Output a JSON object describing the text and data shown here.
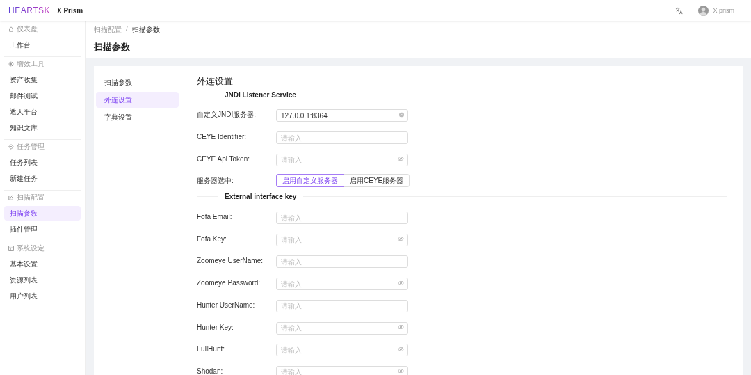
{
  "header": {
    "logo": "HEARTSK",
    "app_name": "X Prism",
    "user": "X prism"
  },
  "sidebar": {
    "groups": [
      {
        "title": "仪表盘",
        "items": [
          {
            "label": "工作台",
            "selected": false
          }
        ]
      },
      {
        "title": "增效工具",
        "items": [
          {
            "label": "资产收集",
            "selected": false
          },
          {
            "label": "邮件测试",
            "selected": false
          },
          {
            "label": "遮天平台",
            "selected": false
          },
          {
            "label": "知识文库",
            "selected": false
          }
        ]
      },
      {
        "title": "任务管理",
        "items": [
          {
            "label": "任务列表",
            "selected": false
          },
          {
            "label": "新建任务",
            "selected": false
          }
        ]
      },
      {
        "title": "扫描配置",
        "items": [
          {
            "label": "扫描参数",
            "selected": true
          },
          {
            "label": "插件管理",
            "selected": false
          }
        ]
      },
      {
        "title": "系统设定",
        "items": [
          {
            "label": "基本设置",
            "selected": false
          },
          {
            "label": "资源列表",
            "selected": false
          },
          {
            "label": "用户列表",
            "selected": false
          }
        ]
      }
    ]
  },
  "breadcrumb": {
    "separator": "/",
    "items": [
      "扫描配置",
      "扫描参数"
    ]
  },
  "page_title": "扫描参数",
  "settings_menu": [
    {
      "label": "扫描参数",
      "selected": false
    },
    {
      "label": "外连设置",
      "selected": true
    },
    {
      "label": "字典设置",
      "selected": false
    }
  ],
  "form": {
    "title": "外连设置",
    "sections": [
      {
        "heading": "JNDI Listener Service",
        "rows": [
          {
            "kind": "clearable",
            "label": "自定义JNDI服务器:",
            "value": "127.0.0.1:8364"
          },
          {
            "kind": "text",
            "label": "CEYE Identifier:",
            "placeholder": "请输入"
          },
          {
            "kind": "password",
            "label": "CEYE Api Token:",
            "placeholder": "请输入"
          },
          {
            "kind": "choice",
            "label": "服务器选中:",
            "options": [
              {
                "label": "启用自定义服务器",
                "selected": true
              },
              {
                "label": "启用CEYE服务器",
                "selected": false
              }
            ]
          }
        ]
      },
      {
        "heading": "External interface key",
        "rows": [
          {
            "kind": "text",
            "label": "Fofa Email:",
            "placeholder": "请输入"
          },
          {
            "kind": "password",
            "label": "Fofa Key:",
            "placeholder": "请输入"
          },
          {
            "kind": "text",
            "label": "Zoomeye UserName:",
            "placeholder": "请输入"
          },
          {
            "kind": "password",
            "label": "Zoomeye Password:",
            "placeholder": "请输入"
          },
          {
            "kind": "text",
            "label": "Hunter UserName:",
            "placeholder": "请输入"
          },
          {
            "kind": "password",
            "label": "Hunter Key:",
            "placeholder": "请输入"
          },
          {
            "kind": "password",
            "label": "FullHunt:",
            "placeholder": "请输入"
          },
          {
            "kind": "password",
            "label": "Shodan:",
            "placeholder": "请输入"
          }
        ]
      }
    ]
  }
}
